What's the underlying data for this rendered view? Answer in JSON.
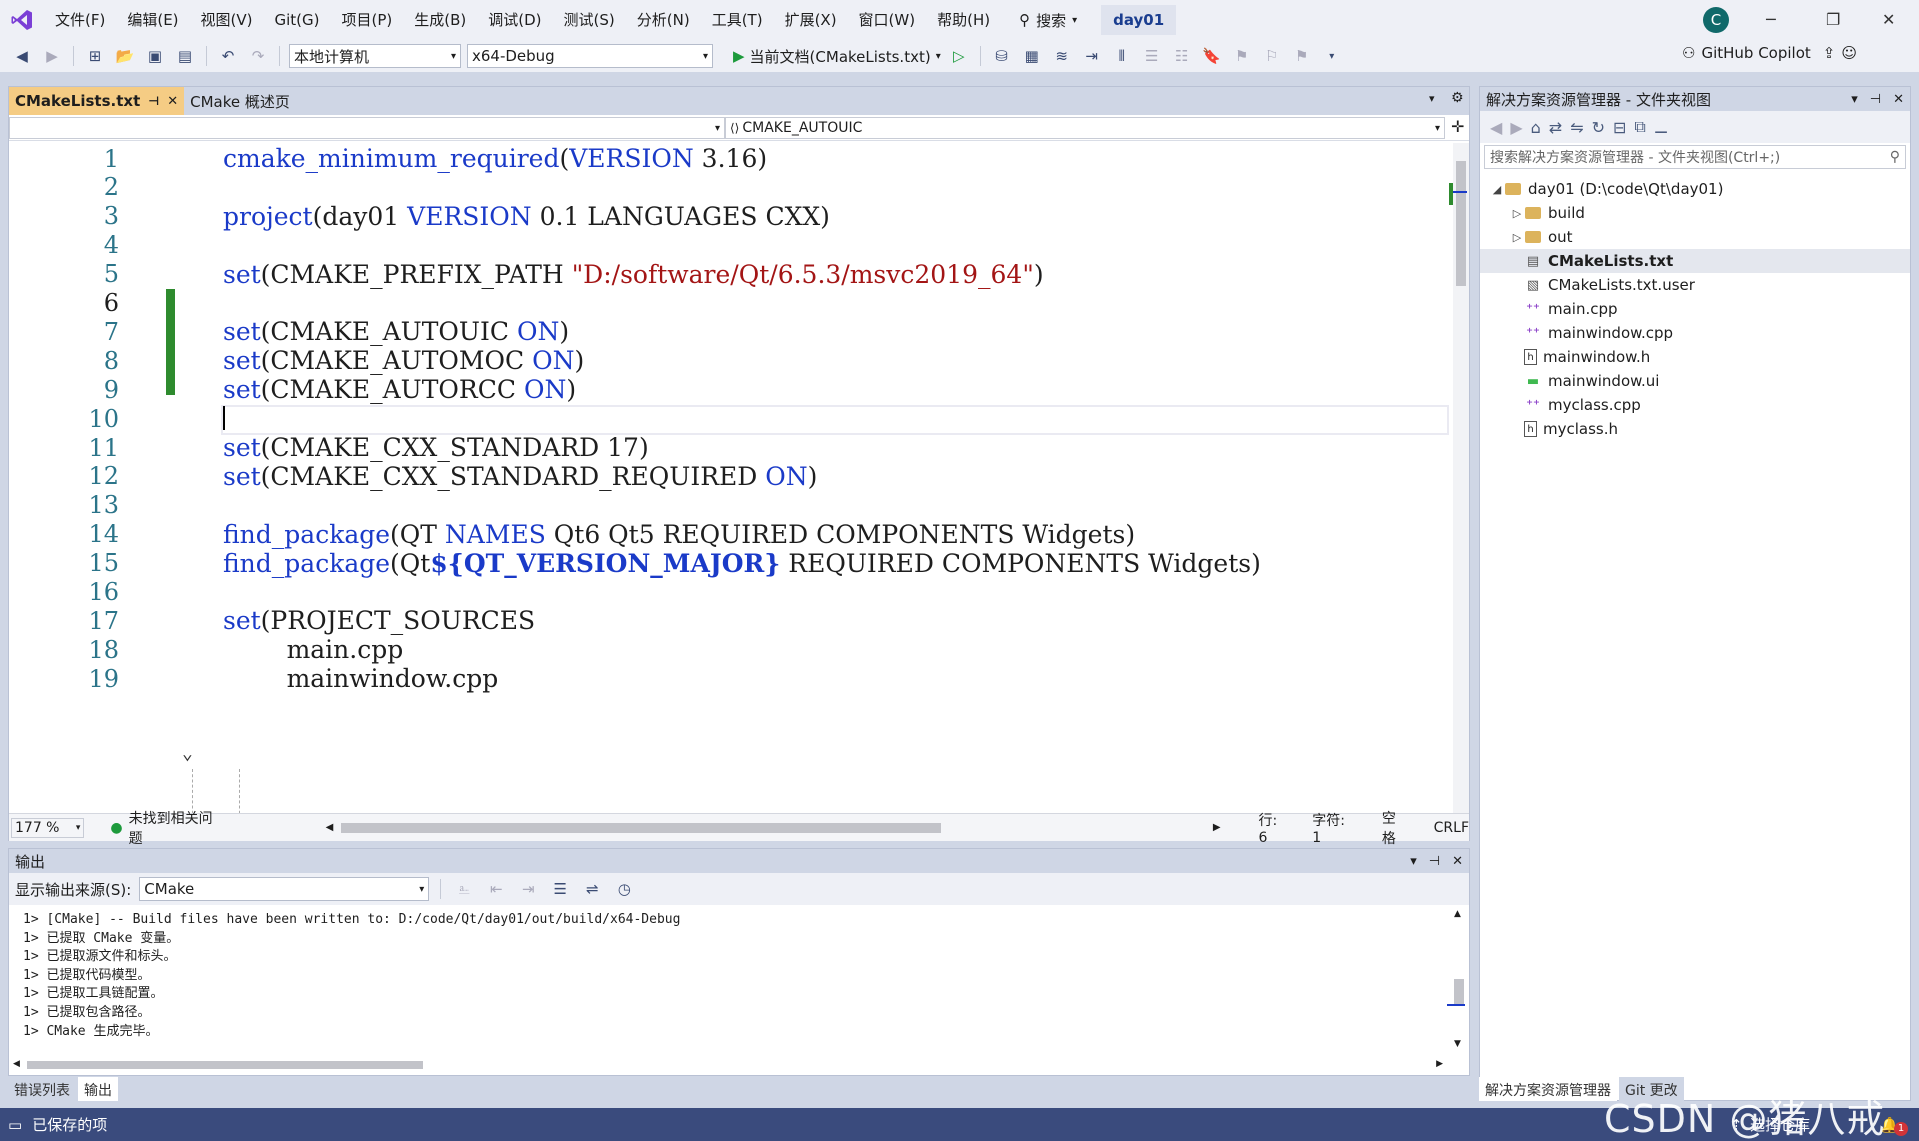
{
  "menu": [
    "文件(F)",
    "编辑(E)",
    "视图(V)",
    "Git(G)",
    "项目(P)",
    "生成(B)",
    "调试(D)",
    "测试(S)",
    "分析(N)",
    "工具(T)",
    "扩展(X)",
    "窗口(W)",
    "帮助(H)"
  ],
  "search_label": "搜索",
  "solution_name": "day01",
  "avatar_letter": "C",
  "toolbar": {
    "target": "本地计算机",
    "config": "x64-Debug",
    "run_label": "当前文档(CMakeLists.txt)",
    "copilot": "GitHub Copilot"
  },
  "editor": {
    "tabs": [
      "CMakeLists.txt",
      "CMake 概述页"
    ],
    "nav_right": "CMAKE_AUTOUIC",
    "zoom": "177 %",
    "issues": "未找到相关问题",
    "row": "行: 6",
    "col": "字符: 1",
    "spacing": "空格",
    "eol": "CRLF",
    "lines": [
      {
        "n": "1",
        "parts": [
          [
            "kw",
            "cmake_minimum_required"
          ],
          [
            "",
            "("
          ],
          [
            "kw",
            "VERSION"
          ],
          [
            "",
            " 3.16)"
          ]
        ]
      },
      {
        "n": "2",
        "parts": []
      },
      {
        "n": "3",
        "parts": [
          [
            "kw",
            "project"
          ],
          [
            "",
            "(day01 "
          ],
          [
            "kw",
            "VERSION"
          ],
          [
            "",
            " 0.1 LANGUAGES CXX)"
          ]
        ]
      },
      {
        "n": "4",
        "parts": []
      },
      {
        "n": "5",
        "parts": [
          [
            "kw",
            "set"
          ],
          [
            "",
            "(CMAKE_PREFIX_PATH "
          ],
          [
            "str",
            "\"D:/software/Qt/6.5.3/msvc2019_64\""
          ],
          [
            "",
            ")"
          ]
        ]
      },
      {
        "n": "6",
        "parts": []
      },
      {
        "n": "7",
        "parts": [
          [
            "kw",
            "set"
          ],
          [
            "",
            "(CMAKE_AUTOUIC "
          ],
          [
            "kw",
            "ON"
          ],
          [
            "",
            ")"
          ]
        ]
      },
      {
        "n": "8",
        "parts": [
          [
            "kw",
            "set"
          ],
          [
            "",
            "(CMAKE_AUTOMOC "
          ],
          [
            "kw",
            "ON"
          ],
          [
            "",
            ")"
          ]
        ]
      },
      {
        "n": "9",
        "parts": [
          [
            "kw",
            "set"
          ],
          [
            "",
            "(CMAKE_AUTORCC "
          ],
          [
            "kw",
            "ON"
          ],
          [
            "",
            ")"
          ]
        ]
      },
      {
        "n": "10",
        "parts": []
      },
      {
        "n": "11",
        "parts": [
          [
            "kw",
            "set"
          ],
          [
            "",
            "(CMAKE_CXX_STANDARD 17)"
          ]
        ]
      },
      {
        "n": "12",
        "parts": [
          [
            "kw",
            "set"
          ],
          [
            "",
            "(CMAKE_CXX_STANDARD_REQUIRED "
          ],
          [
            "kw",
            "ON"
          ],
          [
            "",
            ")"
          ]
        ]
      },
      {
        "n": "13",
        "parts": []
      },
      {
        "n": "14",
        "parts": [
          [
            "kw",
            "find_package"
          ],
          [
            "",
            "(QT "
          ],
          [
            "kw",
            "NAMES"
          ],
          [
            "",
            " Qt6 Qt5 REQUIRED COMPONENTS Widgets)"
          ]
        ]
      },
      {
        "n": "15",
        "parts": [
          [
            "kw",
            "find_package"
          ],
          [
            "",
            "(Qt"
          ],
          [
            "var",
            "${QT_VERSION_MAJOR}"
          ],
          [
            "",
            " REQUIRED COMPONENTS Widgets)"
          ]
        ]
      },
      {
        "n": "16",
        "parts": []
      },
      {
        "n": "17",
        "parts": [
          [
            "kw",
            "set"
          ],
          [
            "",
            "(PROJECT_SOURCES"
          ]
        ]
      },
      {
        "n": "18",
        "parts": [
          [
            "",
            "        main.cpp"
          ]
        ]
      },
      {
        "n": "19",
        "parts": [
          [
            "",
            "        mainwindow.cpp"
          ]
        ]
      }
    ]
  },
  "output": {
    "title": "输出",
    "source_label": "显示输出来源(S):",
    "source_value": "CMake",
    "lines": [
      "1> [CMake] -- Build files have been written to: D:/code/Qt/day01/out/build/x64-Debug",
      "1> 已提取 CMake 变量。",
      "1> 已提取源文件和标头。",
      "1> 已提取代码模型。",
      "1> 已提取工具链配置。",
      "1> 已提取包含路径。",
      "1> CMake 生成完毕。"
    ],
    "tabs": [
      "错误列表",
      "输出"
    ]
  },
  "solution_explorer": {
    "title": "解决方案资源管理器 - 文件夹视图",
    "search_placeholder": "搜索解决方案资源管理器 - 文件夹视图(Ctrl+;)",
    "tree": [
      {
        "label": "day01 (D:\\code\\Qt\\day01)",
        "type": "folder",
        "depth": 0,
        "arrow": "◢"
      },
      {
        "label": "build",
        "type": "folder",
        "depth": 1,
        "arrow": "▷"
      },
      {
        "label": "out",
        "type": "folder",
        "depth": 1,
        "arrow": "▷"
      },
      {
        "label": "CMakeLists.txt",
        "type": "cmake",
        "depth": 1,
        "arrow": "",
        "selected": true
      },
      {
        "label": "CMakeLists.txt.user",
        "type": "file",
        "depth": 1,
        "arrow": ""
      },
      {
        "label": "main.cpp",
        "type": "cpp",
        "depth": 1,
        "arrow": ""
      },
      {
        "label": "mainwindow.cpp",
        "type": "cpp",
        "depth": 1,
        "arrow": ""
      },
      {
        "label": "mainwindow.h",
        "type": "h",
        "depth": 1,
        "arrow": ""
      },
      {
        "label": "mainwindow.ui",
        "type": "ui",
        "depth": 1,
        "arrow": ""
      },
      {
        "label": "myclass.cpp",
        "type": "cpp",
        "depth": 1,
        "arrow": ""
      },
      {
        "label": "myclass.h",
        "type": "h",
        "depth": 1,
        "arrow": ""
      }
    ],
    "tabs": [
      "解决方案资源管理器",
      "Git 更改"
    ]
  },
  "status": {
    "saved": "已保存的项",
    "repo": "选择仓库",
    "notifications": "1"
  },
  "watermark": "CSDN @猪八戒1.0",
  "colors": {
    "accent": "#3a4b7d",
    "active_tab": "#f5cc84",
    "keyword": "#1a3ac8",
    "string": "#a31515",
    "change_bar": "#2e8b2e"
  }
}
